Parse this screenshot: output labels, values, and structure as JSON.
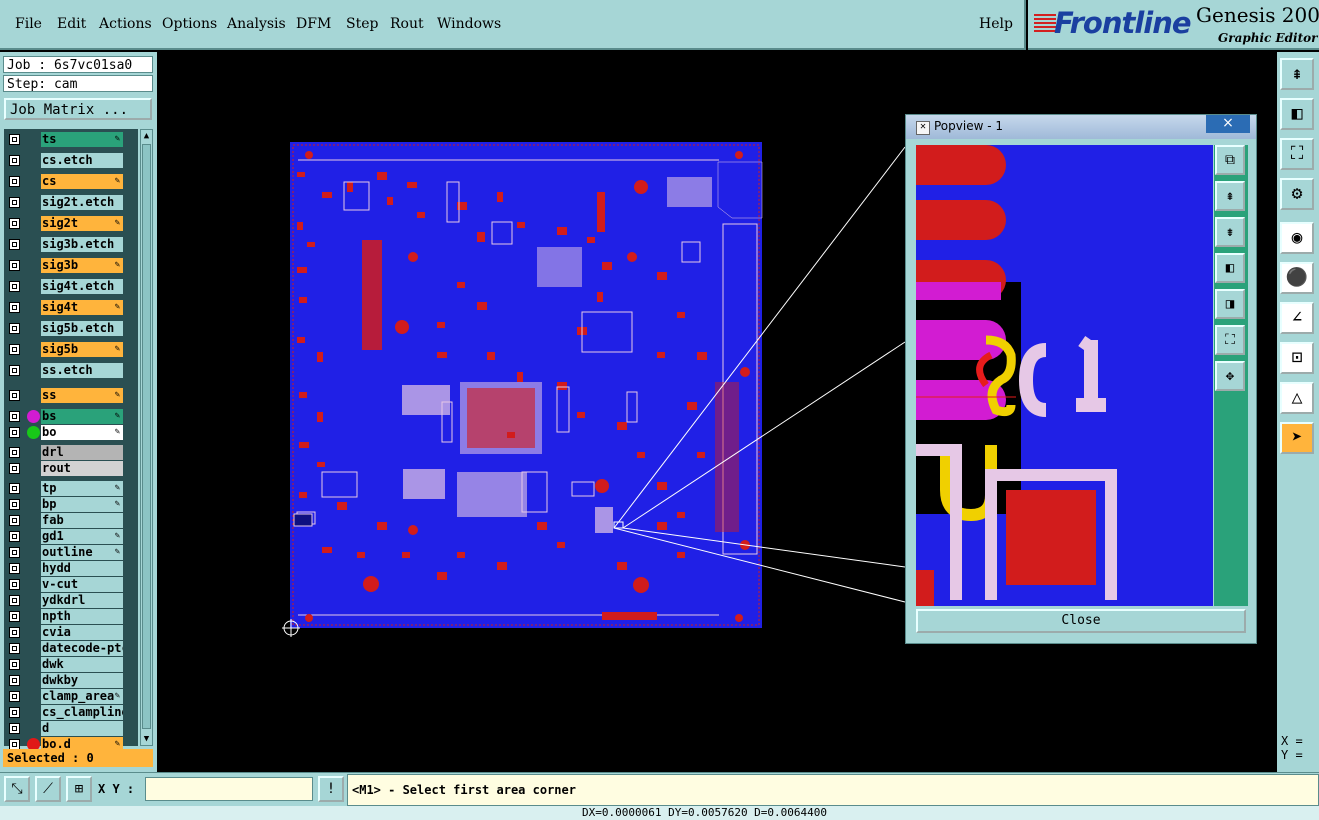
{
  "menu": {
    "items": [
      "File",
      "Edit",
      "Actions",
      "Options",
      "Analysis",
      "DFM",
      "Step",
      "Rout",
      "Windows"
    ],
    "help": "Help"
  },
  "logo": {
    "brand": "Frontline",
    "product": "Genesis 200",
    "subtitle": "Graphic Editor"
  },
  "job": {
    "job_line": "Job : 6s7vc01sa0",
    "step_line": "Step: cam",
    "matrix_button": "Job Matrix ..."
  },
  "layers": [
    {
      "name": "ts",
      "bg": "#2aa27a",
      "edit": true
    },
    {
      "name": "cs.etch",
      "bg": "#a6d6d6",
      "edit": false
    },
    {
      "name": "cs",
      "bg": "#ffb43c",
      "edit": true
    },
    {
      "name": "sig2t.etch",
      "bg": "#a6d6d6",
      "edit": false
    },
    {
      "name": "sig2t",
      "bg": "#ffb43c",
      "edit": true
    },
    {
      "name": "sig3b.etch",
      "bg": "#a6d6d6",
      "edit": false
    },
    {
      "name": "sig3b",
      "bg": "#ffb43c",
      "edit": true
    },
    {
      "name": "sig4t.etch",
      "bg": "#a6d6d6",
      "edit": false
    },
    {
      "name": "sig4t",
      "bg": "#ffb43c",
      "edit": true
    },
    {
      "name": "sig5b.etch",
      "bg": "#a6d6d6",
      "edit": false
    },
    {
      "name": "sig5b",
      "bg": "#ffb43c",
      "edit": true
    },
    {
      "name": "ss.etch",
      "bg": "#a6d6d6",
      "edit": false
    },
    {
      "name": "ss",
      "bg": "#ffb43c",
      "edit": true
    },
    {
      "name": "bs",
      "bg": "#2aa27a",
      "edit": true,
      "dot": "#d21cd2"
    },
    {
      "name": "bo",
      "bg": "#ffffff",
      "edit": true,
      "dot": "#18c818"
    },
    {
      "name": "drl",
      "bg": "#b4b4b4",
      "edit": false
    },
    {
      "name": "rout",
      "bg": "#d2d2d2",
      "edit": false
    },
    {
      "name": "tp",
      "bg": "#a6d6d6",
      "edit": true
    },
    {
      "name": "bp",
      "bg": "#a6d6d6",
      "edit": true
    },
    {
      "name": "fab",
      "bg": "#a6d6d6",
      "edit": false
    },
    {
      "name": "gd1",
      "bg": "#a6d6d6",
      "edit": true
    },
    {
      "name": "outline",
      "bg": "#a6d6d6",
      "edit": true
    },
    {
      "name": "hydd",
      "bg": "#a6d6d6",
      "edit": false
    },
    {
      "name": "v-cut",
      "bg": "#a6d6d6",
      "edit": false
    },
    {
      "name": "ydkdrl",
      "bg": "#a6d6d6",
      "edit": false
    },
    {
      "name": "npth",
      "bg": "#a6d6d6",
      "edit": false
    },
    {
      "name": "cvia",
      "bg": "#a6d6d6",
      "edit": false
    },
    {
      "name": "datecode-ptc",
      "bg": "#a6d6d6",
      "edit": false
    },
    {
      "name": "dwk",
      "bg": "#a6d6d6",
      "edit": false
    },
    {
      "name": "dwkby",
      "bg": "#a6d6d6",
      "edit": false
    },
    {
      "name": "clamp_area",
      "bg": "#a6d6d6",
      "edit": true
    },
    {
      "name": "cs_clampline",
      "bg": "#a6d6d6",
      "edit": false
    },
    {
      "name": "d",
      "bg": "#a6d6d6",
      "edit": false
    },
    {
      "name": "bo.d",
      "bg": "#ffb43c",
      "edit": true,
      "dot": "#e01818"
    }
  ],
  "selected": "Selected : 0",
  "popview": {
    "title": "Popview - 1",
    "close_button": "Close",
    "close_glyph": "×"
  },
  "bottom": {
    "xy_label": "X Y :",
    "xy_value": "",
    "prompt": "<M1> - Select first area corner"
  },
  "coord_readout": {
    "x": "X = ",
    "y": "Y = "
  },
  "status": "DX=0.0000061 DY=0.0057620 D=0.0064400",
  "colors": {
    "panel": "#a6d6d6",
    "board": "#2020e6",
    "pad": "#d21c1c",
    "silk": "#e6c8e6",
    "accent": "#ffb43c"
  }
}
